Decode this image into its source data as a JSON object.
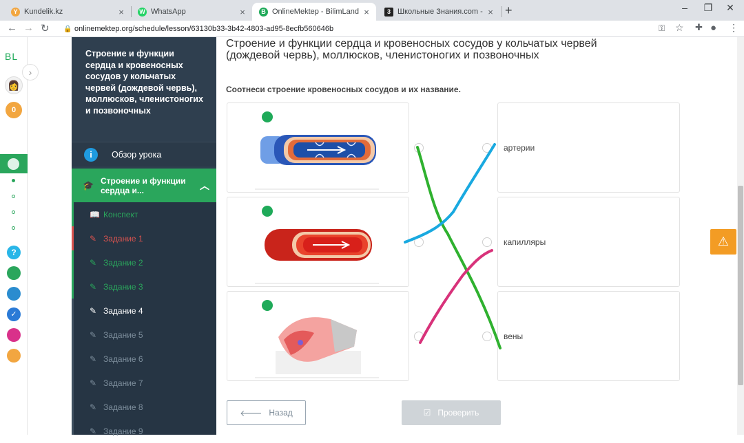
{
  "browser": {
    "tabs": [
      {
        "title": "Kundelik.kz",
        "close": "×",
        "favicon": "Y"
      },
      {
        "title": "WhatsApp",
        "close": "×",
        "favicon": "W"
      },
      {
        "title": "OnlineMektep - BilimLand",
        "close": "×",
        "favicon": "B"
      },
      {
        "title": "Школьные Знания.com - Решае",
        "close": "×",
        "favicon": "3"
      }
    ],
    "new_tab": "+",
    "url": "onlinemektep.org/schedule/lesson/63130b33-3b42-4803-ad95-8ecfb560646b"
  },
  "rail": {
    "logo": "BL",
    "coins": "0"
  },
  "sidebar": {
    "lesson_title": "Строение и функции сердца и кровеносных сосудов у кольчатых червей (дождевой червь), моллюсков, членистоногих и позвоночных",
    "overview_label": "Обзор урока",
    "section_label": "Строение и функции сердца и...",
    "items": [
      {
        "label": "Конспект",
        "state": "done"
      },
      {
        "label": "Задание 1",
        "state": "wrong"
      },
      {
        "label": "Задание 2",
        "state": "done"
      },
      {
        "label": "Задание 3",
        "state": "done"
      },
      {
        "label": "Задание 4",
        "state": "current"
      },
      {
        "label": "Задание 5",
        "state": "locked"
      },
      {
        "label": "Задание 6",
        "state": "locked"
      },
      {
        "label": "Задание 7",
        "state": "locked"
      },
      {
        "label": "Задание 8",
        "state": "locked"
      },
      {
        "label": "Задание 9",
        "state": "locked"
      }
    ]
  },
  "main": {
    "title": "Строение и функции сердца и кровеносных сосудов у кольчатых червей (дождевой червь), моллюсков, членистоногих и позвоночных",
    "instruction": "Соотнеси строение кровеносных сосудов и их название.",
    "answers": [
      "артерии",
      "капилляры",
      "вены"
    ],
    "back_label": "Назад",
    "check_label": "Проверить"
  },
  "colors": {
    "sidebar_bg": "#2f3f4f",
    "accent_green": "#2aa65c",
    "line_green": "#2fb12f",
    "line_blue": "#19a9e0",
    "line_pink": "#d8327a",
    "alert_orange": "#f39c24"
  }
}
